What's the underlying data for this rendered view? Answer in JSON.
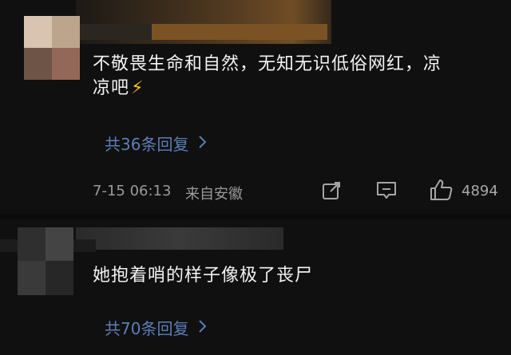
{
  "comments": [
    {
      "text_line1": "不敬畏生命和自然，无知无识低俗网红，凉",
      "text_line2": "凉吧",
      "emoji": "⚡",
      "replies_label": "共36条回复",
      "time": "7-15 06:13",
      "location": "来自安徽",
      "likes": "4894"
    },
    {
      "text_line1": "她抱着哨的样子像极了丧尸",
      "replies_label": "共70条回复"
    }
  ],
  "icons": {
    "reply_chevron": "chevron-right-icon",
    "share": "share-icon",
    "comment": "comment-icon",
    "like": "thumbs-up-icon"
  },
  "colors": {
    "background": "#101010",
    "text": "#f2f2f2",
    "link": "#5b7fb6",
    "meta": "#9a9a9a"
  }
}
